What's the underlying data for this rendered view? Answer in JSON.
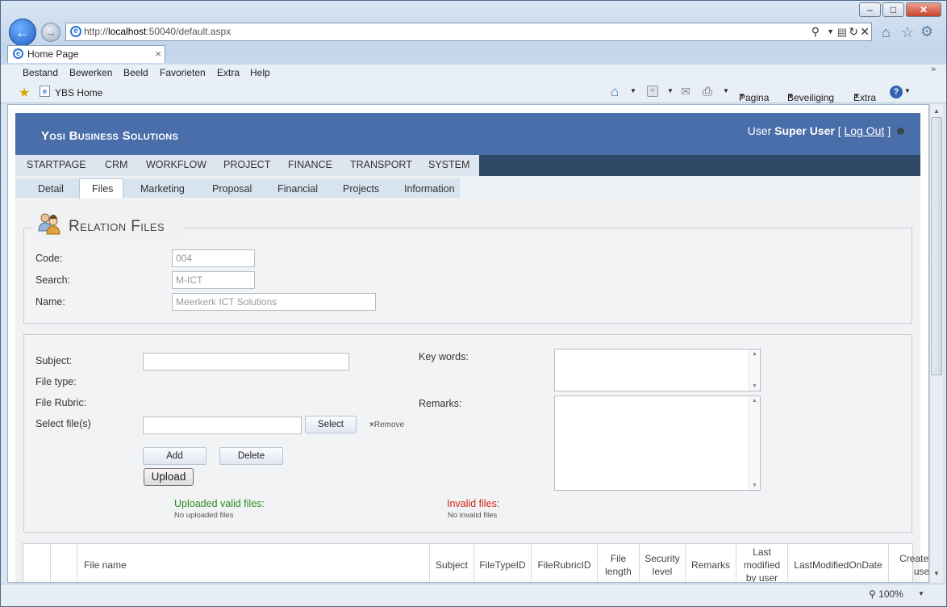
{
  "browser": {
    "address": {
      "prefix": "http://",
      "host": "localhost",
      "rest": ":50040/default.aspx"
    },
    "tab_title": "Home Page",
    "tab_close": "×",
    "menu": [
      "Bestand",
      "Bewerken",
      "Beeld",
      "Favorieten",
      "Extra",
      "Help"
    ],
    "favorites_link": "YBS Home",
    "command_bar": {
      "page": "Pagina",
      "security": "Beveiliging",
      "tools": "Extra"
    },
    "zoom": "100%",
    "controls": {
      "minimize": "–",
      "maximize": "□",
      "close": "✕"
    }
  },
  "app": {
    "brand": "Yosi Business Solutions",
    "user_prefix": "User",
    "user_name": "Super User",
    "logout": "Log Out",
    "main_nav": [
      "STARTPAGE",
      "CRM",
      "WORKFLOW",
      "PROJECT",
      "FINANCE",
      "TRANSPORT",
      "SYSTEM"
    ],
    "sub_nav": [
      "Detail",
      "Files",
      "Marketing",
      "Proposal",
      "Financial",
      "Projects",
      "Information"
    ],
    "active_sub_tab": "Files"
  },
  "relation": {
    "heading": "Relation Files",
    "code_label": "Code:",
    "code_value": "004",
    "search_label": "Search:",
    "search_value": "M-ICT",
    "name_label": "Name:",
    "name_value": "Meerkerk ICT Solutions"
  },
  "upload_form": {
    "subject_label": "Subject:",
    "filetype_label": "File type:",
    "filerubric_label": "File Rubric:",
    "select_files_label": "Select file(s)",
    "select_button": "Select",
    "remove_link": "Remove",
    "add_button": "Add",
    "delete_button": "Delete",
    "upload_button": "Upload",
    "keywords_label": "Key words:",
    "remarks_label": "Remarks:",
    "valid_title": "Uploaded valid files:",
    "valid_empty": "No uploaded files",
    "invalid_title": "Invalid files:",
    "invalid_empty": "No invalid files",
    "valid_color": "#2e8b1e",
    "invalid_color": "#d0241a"
  },
  "grid": {
    "columns": [
      "File name",
      "Subject",
      "FileTypeID",
      "FileRubricID",
      "File length",
      "Security level",
      "Remarks",
      "Last modified by user",
      "LastModifiedOnDate",
      "Created by user"
    ]
  }
}
